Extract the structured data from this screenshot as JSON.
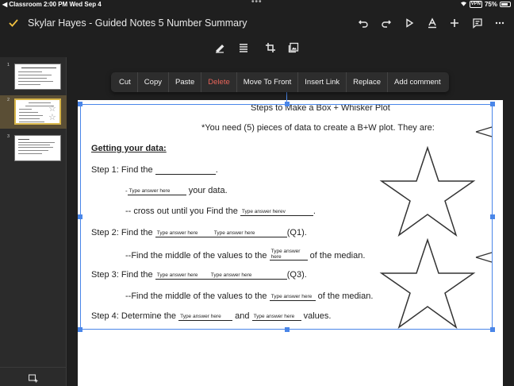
{
  "status_bar": {
    "back_app": "◀ Classroom",
    "time": "2:00 PM",
    "date": "Wed Sep 4",
    "vpn": "VPN",
    "battery": "75%"
  },
  "title_bar": {
    "doc_title": "Skylar Hayes - Guided Notes 5 Number Summary",
    "icons": [
      "check-icon",
      "undo-icon",
      "redo-icon",
      "present-icon",
      "text-format-icon",
      "add-icon",
      "comment-icon",
      "more-icon"
    ]
  },
  "format_bar": {
    "icons": [
      "pen-icon",
      "align-icon",
      "crop-icon",
      "replace-image-icon"
    ]
  },
  "sidebar": {
    "slides": [
      {
        "number": "1"
      },
      {
        "number": "2"
      },
      {
        "number": "3"
      }
    ]
  },
  "context_menu": {
    "items": [
      "Cut",
      "Copy",
      "Paste",
      "Delete",
      "Move To Front",
      "Insert Link",
      "Replace",
      "Add comment"
    ]
  },
  "slide": {
    "title": "Steps to Make a Box + Whisker Plot",
    "subtitle": "*You need (5) pieces of data to create a B+W plot. They are:",
    "heading": "Getting your data:",
    "step1_label": "Step 1: Find the",
    "step1_end": ".",
    "step1a_blank": "Type answer here",
    "step1a_text": "your data.",
    "step1b_text": "-- cross out until you Find the",
    "step1b_blank": "Type answer herev",
    "step1b_end": ".",
    "step2_label": "Step 2: Find the",
    "step2_blank1": "Type answer here",
    "step2_blank2": "Type answer here",
    "step2_end": "(Q1).",
    "step2a_text": "--Find the middle of the values to the",
    "step2a_blank": "Type answer here",
    "step2a_end": "of the median.",
    "step3_label": "Step 3: Find the",
    "step3_blank1": "Type answer here",
    "step3_blank2": "Type answer here",
    "step3_end": "(Q3).",
    "step3a_text": "--Find the middle of the values to the",
    "step3a_blank": "Type answer here",
    "step3a_end": "of the median.",
    "step4_label": "Step 4: Determine the",
    "step4_blank1": "Type answer here",
    "step4_and": "and",
    "step4_blank2": "Type answer here",
    "step4_end": "values."
  }
}
